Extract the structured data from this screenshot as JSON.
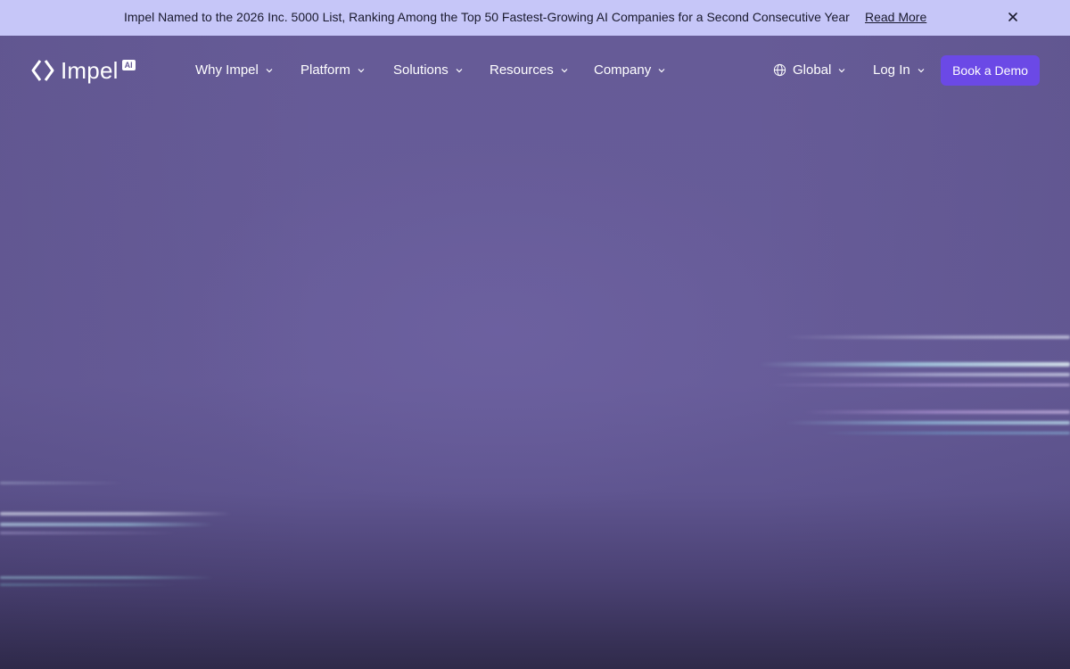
{
  "announcement": {
    "message": "Impel Named to the 2026 Inc. 5000 List, Ranking Among the Top 50 Fastest-Growing AI Companies for a Second Consecutive Year",
    "link_label": "Read More",
    "close_icon": "close-icon"
  },
  "brand": {
    "name": "Impel",
    "badge": "AI",
    "logo_icon": "impel-logo-icon"
  },
  "nav": {
    "items": [
      {
        "label": "Why Impel",
        "icon": "chevron-down-icon"
      },
      {
        "label": "Platform",
        "icon": "chevron-down-icon"
      },
      {
        "label": "Solutions",
        "icon": "chevron-down-icon"
      },
      {
        "label": "Resources",
        "icon": "chevron-down-icon"
      },
      {
        "label": "Company",
        "icon": "chevron-down-icon"
      }
    ],
    "region_label": "Global",
    "region_icon": "globe-icon",
    "login_label": "Log In",
    "cta_label": "Book a Demo"
  },
  "colors": {
    "announcement_bg": "#c6c6f8",
    "hero_bg": "#675c98",
    "cta_bg": "#6b49e6",
    "text_light": "#ffffff"
  }
}
